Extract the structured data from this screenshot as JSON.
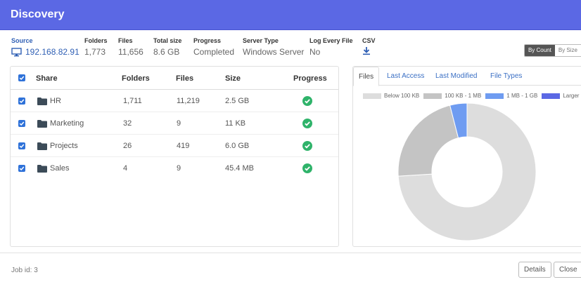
{
  "window": {
    "title": "Discovery"
  },
  "summary": {
    "source": {
      "label": "Source",
      "value": "192.168.82.91"
    },
    "folders": {
      "label": "Folders",
      "value": "1,773"
    },
    "files": {
      "label": "Files",
      "value": "11,656"
    },
    "total_size": {
      "label": "Total size",
      "value": "8.6 GB"
    },
    "progress": {
      "label": "Progress",
      "value": "Completed"
    },
    "server_type": {
      "label": "Server Type",
      "value": "Windows Server"
    },
    "log_every_file": {
      "label": "Log Every File",
      "value": "No"
    },
    "csv": {
      "label": "CSV",
      "icon": "download-icon"
    }
  },
  "view_toggle": {
    "by_count": "By Count",
    "by_size": "By Size",
    "selected": "By Count"
  },
  "shares_table": {
    "headers": {
      "share": "Share",
      "folders": "Folders",
      "files": "Files",
      "size": "Size",
      "progress": "Progress"
    },
    "rows": [
      {
        "share": "HR",
        "folders": "1,711",
        "files": "11,219",
        "size": "2.5 GB",
        "checked": true,
        "status": "complete"
      },
      {
        "share": "Marketing",
        "folders": "32",
        "files": "9",
        "size": "11 KB",
        "checked": true,
        "status": "complete"
      },
      {
        "share": "Projects",
        "folders": "26",
        "files": "419",
        "size": "6.0 GB",
        "checked": true,
        "status": "complete"
      },
      {
        "share": "Sales",
        "folders": "4",
        "files": "9",
        "size": "45.4 MB",
        "checked": true,
        "status": "complete"
      }
    ]
  },
  "chart_tabs": [
    "Files",
    "Last Access",
    "Last Modified",
    "File Types"
  ],
  "chart_data": {
    "type": "pie",
    "categories": [
      "Below 100 KB",
      "100 KB - 1 MB",
      "1 MB - 1 GB",
      "Larger"
    ],
    "values": [
      74,
      22,
      4,
      0
    ],
    "colors": [
      "#dddddd",
      "#c4c4c4",
      "#6f9cf1",
      "#5b68e4"
    ],
    "legend": "top"
  },
  "footer": {
    "job_id": "Job id: 3",
    "details_label": "Details",
    "close_label": "Close"
  },
  "colors": {
    "header": "#5b68e4",
    "link": "#2f5fb4",
    "checkbox": "#2f72d9",
    "success": "#2fb36a"
  }
}
